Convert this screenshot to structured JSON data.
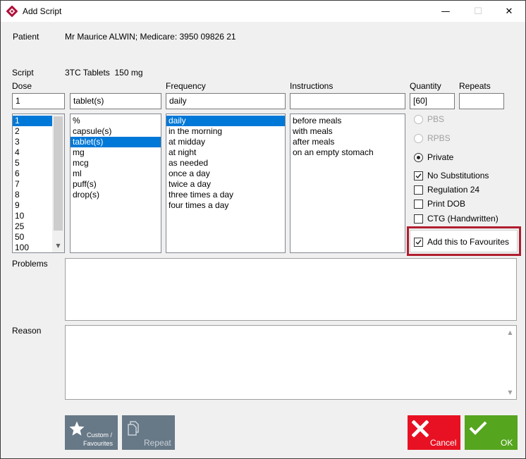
{
  "window": {
    "title": "Add Script",
    "minimize_glyph": "—",
    "maximize_glyph": "☐",
    "close_glyph": "✕"
  },
  "patient": {
    "label": "Patient",
    "value": "Mr Maurice ALWIN; Medicare: 3950 09826 21"
  },
  "script": {
    "label": "Script",
    "value": "3TC Tablets  150 mg"
  },
  "dose": {
    "label": "Dose",
    "value": "1",
    "options": [
      "1",
      "2",
      "3",
      "4",
      "5",
      "6",
      "7",
      "8",
      "9",
      "10",
      "25",
      "50",
      "100"
    ],
    "selected_index": 0
  },
  "unit": {
    "value": "tablet(s)",
    "options": [
      "%",
      "capsule(s)",
      "tablet(s)",
      "mg",
      "mcg",
      "ml",
      "puff(s)",
      "drop(s)"
    ],
    "selected_index": 2
  },
  "frequency": {
    "label": "Frequency",
    "value": "daily",
    "options": [
      "daily",
      "in the morning",
      "at midday",
      "at night",
      "as needed",
      "once a day",
      "twice a day",
      "three times a day",
      "four times a day"
    ],
    "selected_index": 0
  },
  "instructions": {
    "label": "Instructions",
    "value": "",
    "options": [
      "before meals",
      "with meals",
      "after meals",
      "on an empty stomach"
    ]
  },
  "quantity": {
    "label": "Quantity",
    "value": "[60]"
  },
  "repeats": {
    "label": "Repeats",
    "value": ""
  },
  "script_type": {
    "options": [
      {
        "label": "PBS",
        "checked": false,
        "enabled": false
      },
      {
        "label": "RPBS",
        "checked": false,
        "enabled": false
      },
      {
        "label": "Private",
        "checked": true,
        "enabled": true
      }
    ]
  },
  "options": {
    "no_substitutions": {
      "label": "No Substitutions",
      "checked": true
    },
    "regulation_24": {
      "label": "Regulation 24",
      "checked": false
    },
    "print_dob": {
      "label": "Print DOB",
      "checked": false
    },
    "ctg": {
      "label": "CTG (Handwritten)",
      "checked": false
    },
    "add_favourites": {
      "label": "Add this to Favourites",
      "checked": true
    }
  },
  "problems": {
    "label": "Problems",
    "value": ""
  },
  "reason": {
    "label": "Reason",
    "value": ""
  },
  "buttons": {
    "custom_favourites": {
      "line1": "Custom /",
      "line2": "Favourites",
      "icon": "star-icon"
    },
    "repeat": {
      "label": "Repeat",
      "icon": "copy-icon"
    },
    "cancel": {
      "label": "Cancel",
      "icon": "x-icon"
    },
    "ok": {
      "label": "OK",
      "icon": "checkmark-icon"
    }
  },
  "colors": {
    "selection": "#0078d7",
    "highlight_border": "#b01e2e",
    "tile_slate": "#677887",
    "tile_cancel": "#e81123",
    "tile_ok": "#55a51f"
  }
}
